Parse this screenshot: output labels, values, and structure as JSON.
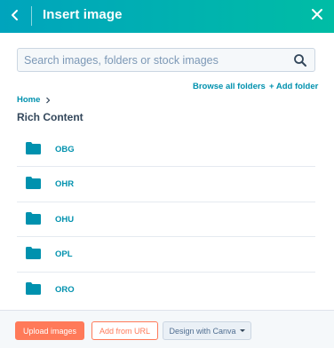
{
  "header": {
    "title": "Insert image",
    "back_icon": "chevron-left-icon",
    "close_icon": "close-icon",
    "gradient_start": "#00a4bd",
    "gradient_end": "#00bda5"
  },
  "search": {
    "placeholder": "Search images, folders or stock images",
    "value": "",
    "icon": "search-icon"
  },
  "links": {
    "browse_all": "Browse all folders",
    "add_folder": "+ Add folder"
  },
  "breadcrumb": {
    "home": "Home"
  },
  "section_title": "Rich Content",
  "folders": [
    {
      "name": "OBG"
    },
    {
      "name": "OHR"
    },
    {
      "name": "OHU"
    },
    {
      "name": "OPL"
    },
    {
      "name": "ORO"
    }
  ],
  "footer": {
    "upload_label": "Upload images",
    "add_url_label": "Add from URL",
    "canva_label": "Design with Canva"
  },
  "colors": {
    "accent": "#0091ae",
    "primary_button": "#ff7a59",
    "text": "#33475b"
  }
}
